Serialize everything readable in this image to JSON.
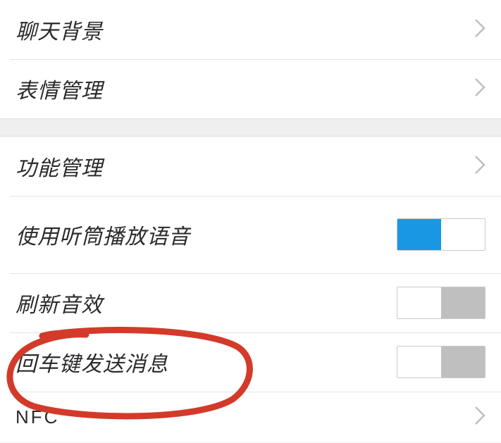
{
  "section1": {
    "chat_background": "聊天背景",
    "sticker_management": "表情管理"
  },
  "section2": {
    "feature_management": "功能管理",
    "earpiece_playback": "使用听筒播放语音",
    "refresh_sound": "刷新音效",
    "enter_to_send": "回车键发送消息",
    "nfc": "NFC"
  },
  "toggles": {
    "earpiece_playback": true,
    "refresh_sound": false,
    "enter_to_send": false
  }
}
